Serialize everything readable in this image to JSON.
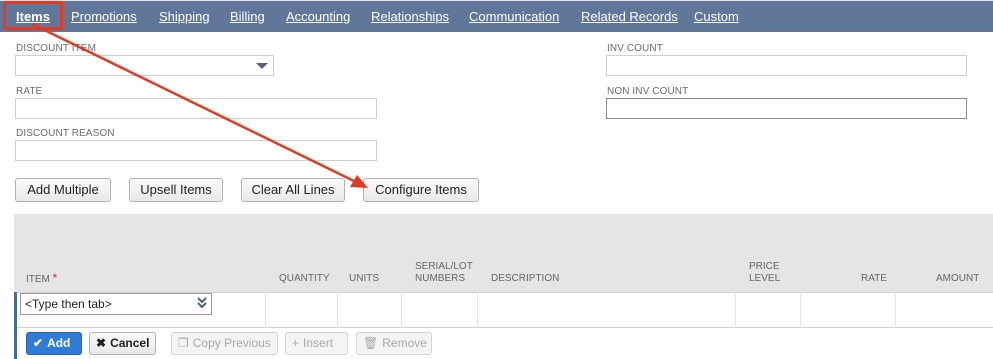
{
  "tabs": [
    {
      "label": "Items",
      "active": true
    },
    {
      "label": "Promotions"
    },
    {
      "label": "Shipping"
    },
    {
      "label": "Billing"
    },
    {
      "label": "Accounting"
    },
    {
      "label": "Relationships"
    },
    {
      "label": "Communication"
    },
    {
      "label": "Related Records"
    },
    {
      "label": "Custom"
    }
  ],
  "fields": {
    "discount_item": {
      "label": "DISCOUNT ITEM",
      "value": ""
    },
    "rate": {
      "label": "RATE",
      "value": ""
    },
    "discount_reason": {
      "label": "DISCOUNT REASON",
      "value": ""
    },
    "inv_count": {
      "label": "INV COUNT",
      "value": ""
    },
    "non_inv_count": {
      "label": "NON INV COUNT",
      "value": ""
    }
  },
  "buttons": {
    "add_multiple": "Add Multiple",
    "upsell_items": "Upsell Items",
    "clear_all_lines": "Clear All Lines",
    "configure_items": "Configure Items"
  },
  "sublist": {
    "columns": {
      "item": "ITEM",
      "required_mark": "*",
      "quantity": "QUANTITY",
      "units": "UNITS",
      "serial_1": "SERIAL/LOT",
      "serial_2": "NUMBERS",
      "description": "DESCRIPTION",
      "price_1": "PRICE",
      "price_2": "LEVEL",
      "rate": "RATE",
      "amount": "AMOUNT"
    },
    "item_placeholder": "<Type then tab>"
  },
  "actions": {
    "add": "Add",
    "cancel": "Cancel",
    "copy_previous": "Copy Previous",
    "insert": "Insert",
    "remove": "Remove"
  },
  "colors": {
    "tabbar": "#607799",
    "highlight": "#e23b22",
    "primary": "#2f7bd6"
  },
  "annotation": {
    "type": "arrow",
    "from": "tab-items",
    "to": "configure-items-button"
  }
}
